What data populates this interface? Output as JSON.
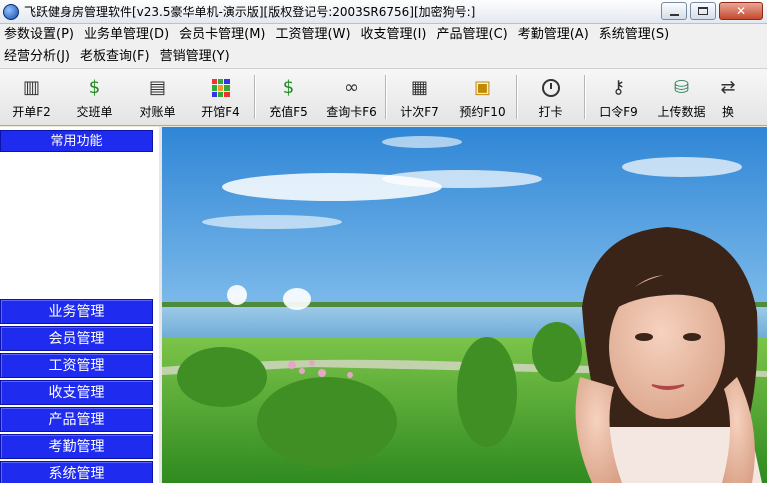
{
  "window": {
    "title": "飞跃健身房管理软件[v23.5豪华单机-演示版][版权登记号:2003SR6756][加密狗号:]"
  },
  "menu": {
    "row1": [
      "参数设置(P)",
      "业务单管理(D)",
      "会员卡管理(M)",
      "工资管理(W)",
      "收支管理(I)",
      "产品管理(C)",
      "考勤管理(A)",
      "系统管理(S)"
    ],
    "row2": [
      "经营分析(J)",
      "老板查询(F)",
      "营销管理(Y)"
    ]
  },
  "toolbar": [
    {
      "label": "开单F2",
      "icon": "document-icon"
    },
    {
      "label": "交班单",
      "icon": "money-bag-icon"
    },
    {
      "label": "对账单",
      "icon": "ledger-icon"
    },
    {
      "label": "开馆F4",
      "icon": "grid-icon"
    },
    {
      "label": "充值F5",
      "icon": "money-bag-icon"
    },
    {
      "label": "查询卡F6",
      "icon": "binoculars-icon"
    },
    {
      "label": "计次F7",
      "icon": "counter-icon"
    },
    {
      "label": "预约F10",
      "icon": "calendar-icon"
    },
    {
      "label": "打卡",
      "icon": "clock-icon"
    },
    {
      "label": "口令F9",
      "icon": "key-icon"
    },
    {
      "label": "上传数据",
      "icon": "database-upload-icon"
    },
    {
      "label": "换",
      "icon": "switch-icon"
    }
  ],
  "sidebar": {
    "header": "常用功能",
    "items": [
      "业务管理",
      "会员管理",
      "工资管理",
      "收支管理",
      "产品管理",
      "考勤管理",
      "系统管理"
    ]
  },
  "colors": {
    "sidebar_blue": "#1f2cf0",
    "title_gradient_top": "#fdfdfd"
  }
}
